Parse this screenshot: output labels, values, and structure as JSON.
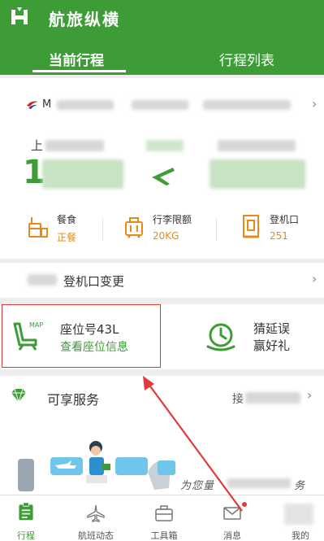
{
  "header": {
    "app_title": "航旅纵横",
    "tabs": [
      {
        "label": "当前行程",
        "active": true
      },
      {
        "label": "行程列表",
        "active": false
      }
    ]
  },
  "flight": {
    "airline_code_partial": "M",
    "origin_partial": "上",
    "departure_time_partial": "1",
    "info": [
      {
        "icon": "meal-icon",
        "label": "餐食",
        "value": "正餐"
      },
      {
        "icon": "luggage-icon",
        "label": "行李限额",
        "value": "20KG"
      },
      {
        "icon": "gate-icon",
        "label": "登机口",
        "value": "251"
      }
    ]
  },
  "gate_change": {
    "text": "登机口变更"
  },
  "seat": {
    "icon_badge": "MAP",
    "seat_number": "座位号43L",
    "view_link": "查看座位信息"
  },
  "promo": {
    "line1": "猜延误",
    "line2": "赢好礼"
  },
  "services": {
    "title": "可享服务",
    "more_partial": "接",
    "caption_partial": "为您量",
    "caption_end": "务"
  },
  "bottom_nav": [
    {
      "label": "行程",
      "icon": "itinerary-icon",
      "active": true
    },
    {
      "label": "航班动态",
      "icon": "flight-status-icon",
      "active": false
    },
    {
      "label": "工具箱",
      "icon": "toolbox-icon",
      "active": false
    },
    {
      "label": "消息",
      "icon": "message-icon",
      "active": false
    },
    {
      "label": "我的",
      "icon": "profile-icon",
      "active": false
    }
  ],
  "colors": {
    "brand_green": "#3d9c35",
    "accent_orange": "#e8891a",
    "annotation_red": "#e03a3a"
  }
}
